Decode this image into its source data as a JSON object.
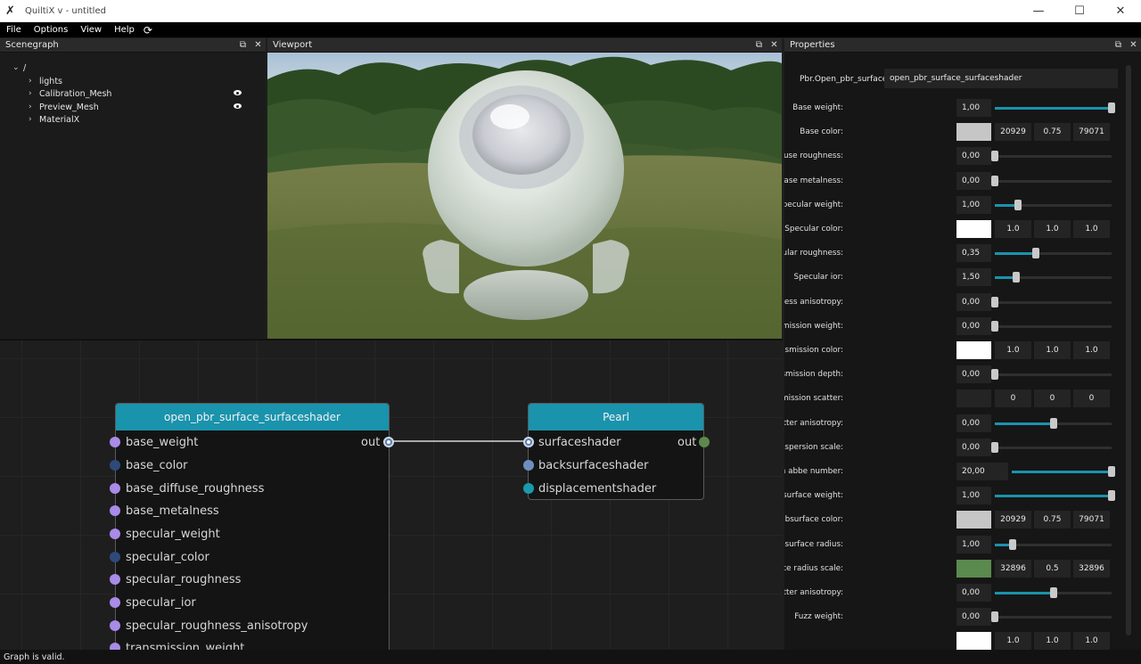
{
  "window": {
    "title": "QuiltiX v - untitled",
    "controls": [
      "—",
      "☐",
      "✕"
    ]
  },
  "menu": [
    "File",
    "Options",
    "View",
    "Help"
  ],
  "scenegraph": {
    "title": "Scenegraph",
    "root": "/",
    "items": [
      {
        "label": "lights",
        "visible_icon": false
      },
      {
        "label": "Calibration_Mesh",
        "visible_icon": true
      },
      {
        "label": "Preview_Mesh",
        "visible_icon": true
      },
      {
        "label": "MaterialX",
        "visible_icon": false
      }
    ]
  },
  "viewport": {
    "title": "Viewport"
  },
  "properties": {
    "title": "Properties",
    "node_type": "Pbr.Open_pbr_surface",
    "node_name": "open_pbr_surface_surfaceshader",
    "rows": [
      {
        "label": "Base weight:",
        "kind": "slider",
        "value": "1,00",
        "level": 1.0
      },
      {
        "label": "Base color:",
        "kind": "color",
        "swatch": "#c6c6c6",
        "components": [
          "20929",
          "0.75",
          "79071"
        ]
      },
      {
        "label": "Base diffuse roughness:",
        "kind": "slider",
        "value": "0,00",
        "level": 0.0
      },
      {
        "label": "Base metalness:",
        "kind": "slider",
        "value": "0,00",
        "level": 0.0
      },
      {
        "label": "Specular weight:",
        "kind": "slider",
        "value": "1,00",
        "level": 0.2
      },
      {
        "label": "Specular color:",
        "kind": "color",
        "swatch": "#ffffff",
        "components": [
          "1.0",
          "1.0",
          "1.0"
        ]
      },
      {
        "label": "Specular roughness:",
        "kind": "slider",
        "value": "0,35",
        "level": 0.35
      },
      {
        "label": "Specular ior:",
        "kind": "slider",
        "value": "1,50",
        "level": 0.18
      },
      {
        "label": "Specular roughness anisotropy:",
        "kind": "slider",
        "value": "0,00",
        "level": 0.0
      },
      {
        "label": "Transmission weight:",
        "kind": "slider",
        "value": "0,00",
        "level": 0.0
      },
      {
        "label": "Transmission color:",
        "kind": "color",
        "swatch": "#ffffff",
        "components": [
          "1.0",
          "1.0",
          "1.0"
        ]
      },
      {
        "label": "Transmission depth:",
        "kind": "slider",
        "value": "0,00",
        "level": 0.0
      },
      {
        "label": "Transmission scatter:",
        "kind": "color",
        "swatch": "#242424",
        "components": [
          "0",
          "0",
          "0"
        ]
      },
      {
        "label": "Transmission scatter anisotropy:",
        "kind": "slider",
        "value": "0,00",
        "level": 0.5
      },
      {
        "label": "Transmission dispersion scale:",
        "kind": "slider",
        "value": "0,00",
        "level": 0.0
      },
      {
        "label": "Transmission dispersion abbe number:",
        "kind": "slider",
        "value": "20,00",
        "level": 1.0
      },
      {
        "label": "Subsurface weight:",
        "kind": "slider",
        "value": "1,00",
        "level": 1.0
      },
      {
        "label": "Subsurface color:",
        "kind": "color",
        "swatch": "#c6c6c6",
        "components": [
          "20929",
          "0.75",
          "79071"
        ]
      },
      {
        "label": "Subsurface radius:",
        "kind": "slider",
        "value": "1,00",
        "level": 0.15
      },
      {
        "label": "Subsurface radius scale:",
        "kind": "color",
        "swatch": "#5a8a4e",
        "components": [
          "32896",
          "0.5",
          "32896"
        ]
      },
      {
        "label": "Subsurface scatter anisotropy:",
        "kind": "slider",
        "value": "0,00",
        "level": 0.5
      },
      {
        "label": "Fuzz weight:",
        "kind": "slider",
        "value": "0,00",
        "level": 0.0
      },
      {
        "label": "",
        "kind": "color",
        "swatch": "#ffffff",
        "components": [
          "1.0",
          "1.0",
          "1.0"
        ]
      }
    ]
  },
  "graph": {
    "nodes": [
      {
        "title": "open_pbr_surface_surfaceshader",
        "header_color": "#1a93ad",
        "output": "out",
        "inputs": [
          "base_weight",
          "base_color",
          "base_diffuse_roughness",
          "base_metalness",
          "specular_weight",
          "specular_color",
          "specular_roughness",
          "specular_ior",
          "specular_roughness_anisotropy",
          "transmission_weight"
        ]
      },
      {
        "title": "Pearl",
        "header_color": "#1a93ad",
        "output": "out",
        "inputs": [
          "surfaceshader",
          "backsurfaceshader",
          "displacementshader"
        ]
      }
    ]
  },
  "status": {
    "message": "Graph is valid."
  }
}
